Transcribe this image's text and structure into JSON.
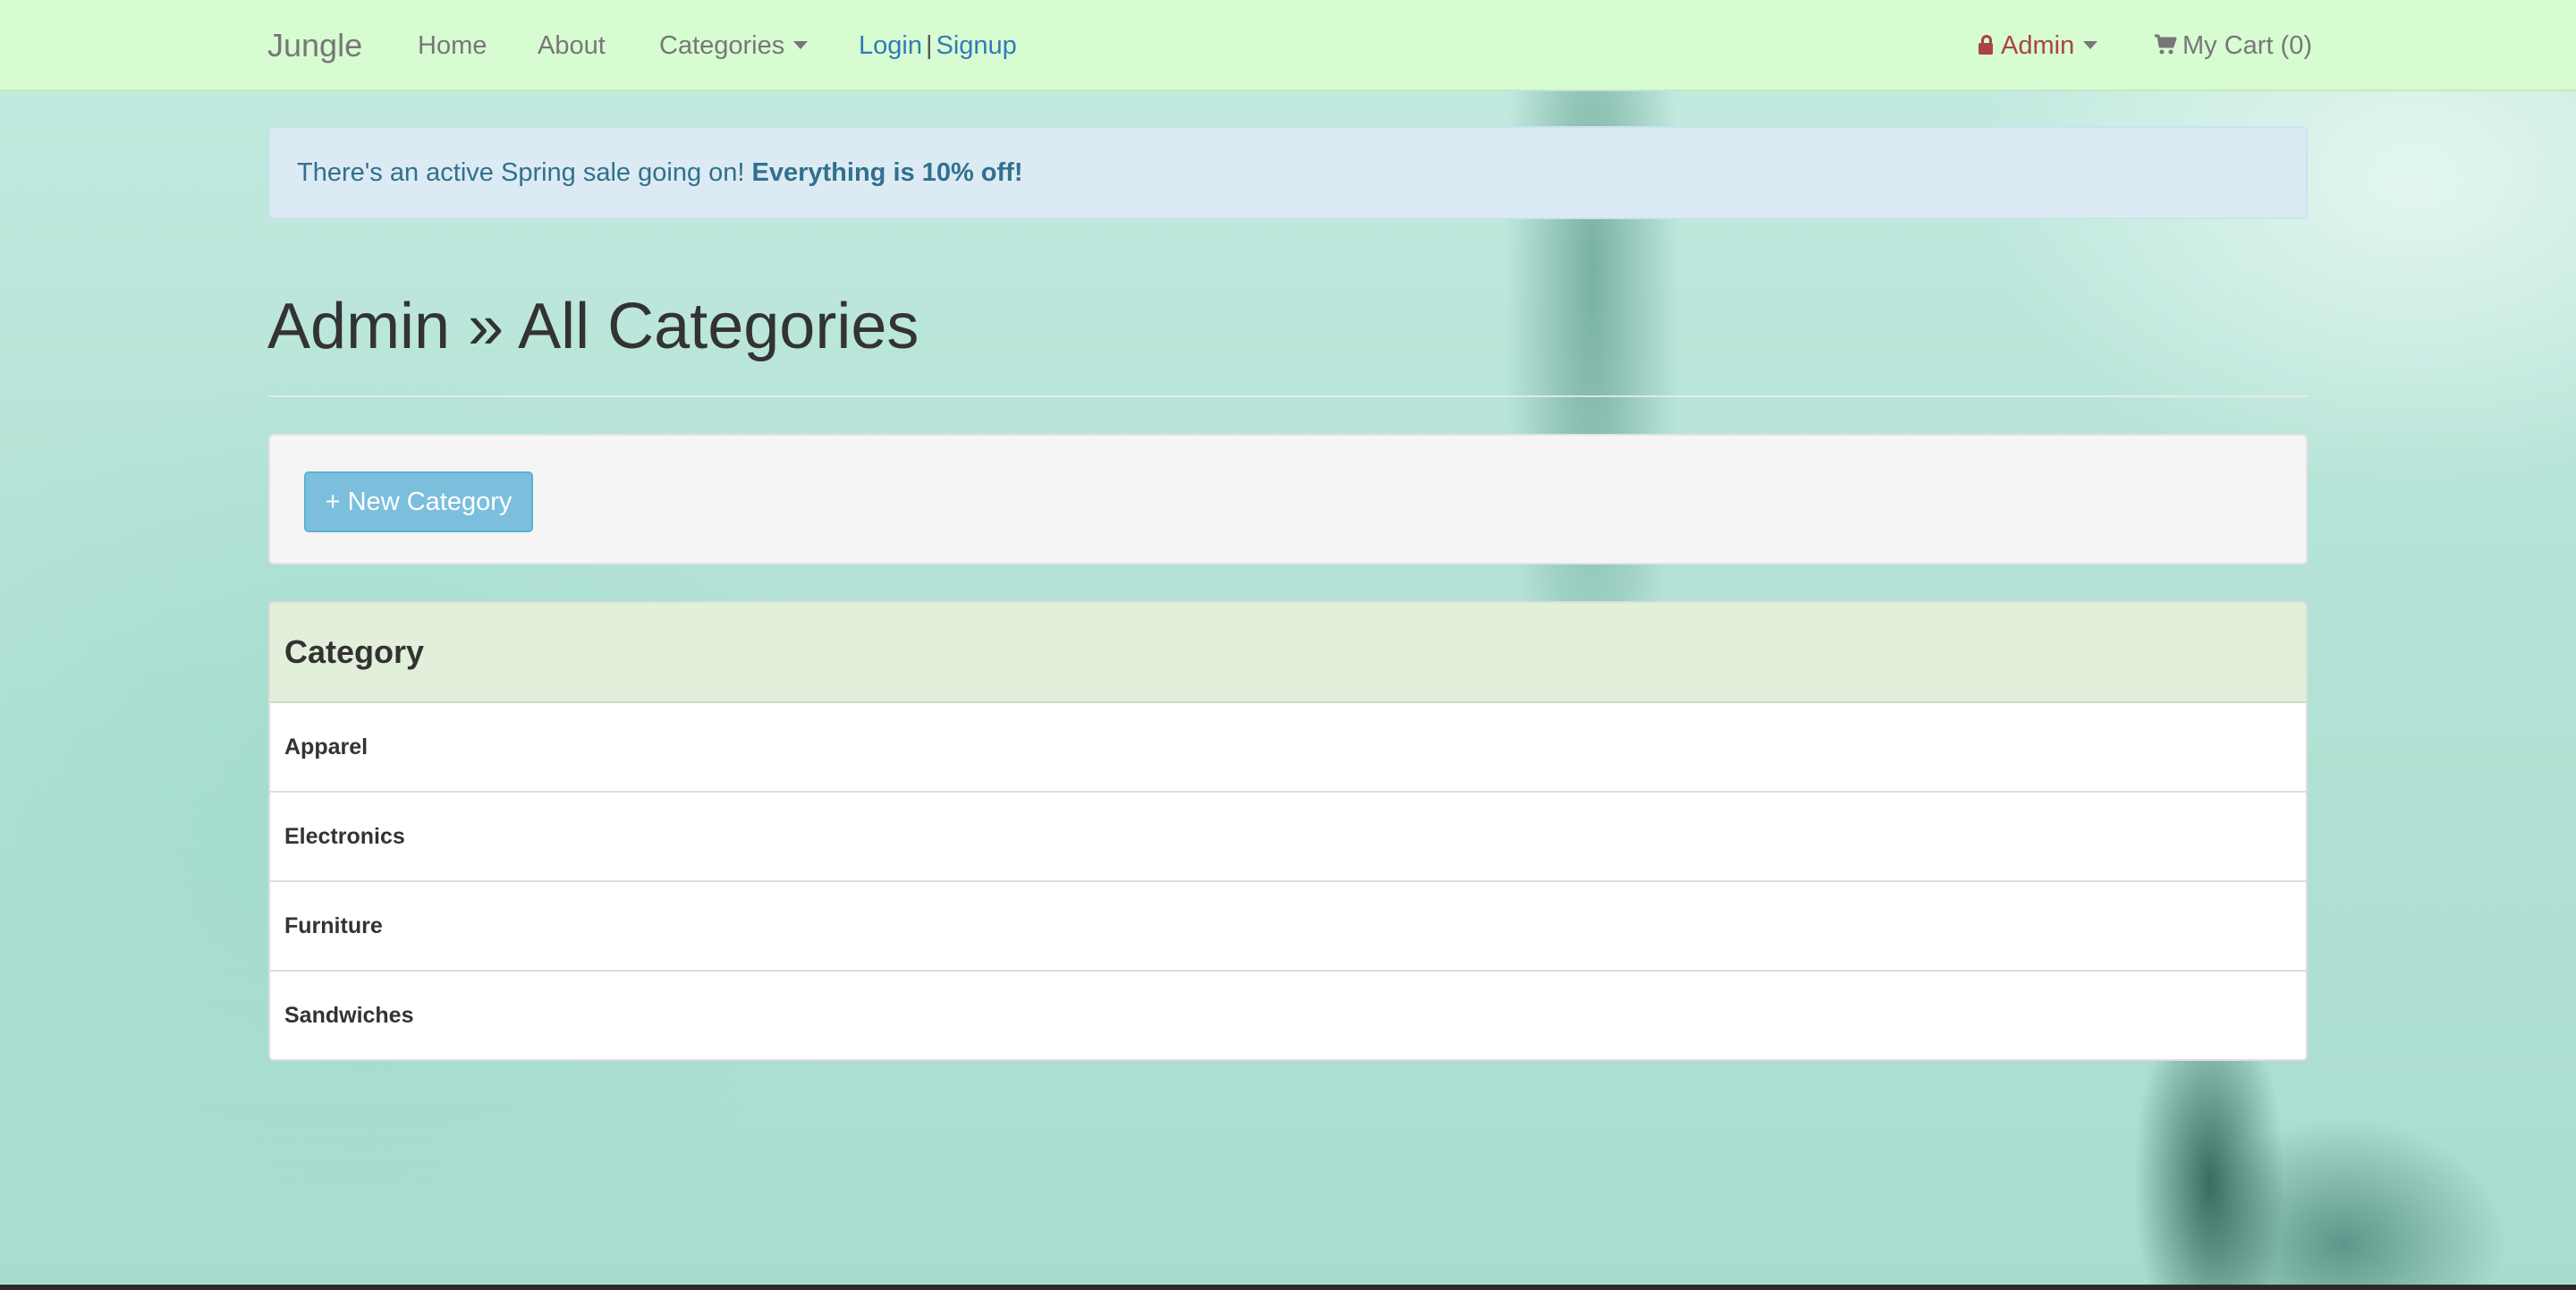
{
  "navbar": {
    "brand": "Jungle",
    "links": {
      "home": "Home",
      "about": "About",
      "categories": "Categories",
      "login": "Login",
      "separator": "|",
      "signup": "Signup"
    },
    "admin_label": "Admin",
    "cart_label": "My Cart (0)"
  },
  "alert": {
    "text": "There's an active Spring sale going on!",
    "bold_text": "Everything is 10% off!"
  },
  "page": {
    "title": "Admin » All Categories"
  },
  "toolbar": {
    "new_category_label": "+ New Category"
  },
  "table": {
    "header": "Category",
    "rows": [
      "Apparel",
      "Electronics",
      "Furniture",
      "Sandwiches"
    ]
  },
  "colors": {
    "navbar_bg": "#d8fcd2",
    "alert_bg": "#dcebf3",
    "alert_text": "#31708f",
    "admin_text": "#a94442",
    "link_blue": "#337ab7",
    "button_bg": "#7cbfdd",
    "table_header_bg": "#e2efda"
  },
  "icons": {
    "admin": "lock-icon",
    "cart": "shopping-cart-icon",
    "dropdown": "caret-down-icon"
  }
}
